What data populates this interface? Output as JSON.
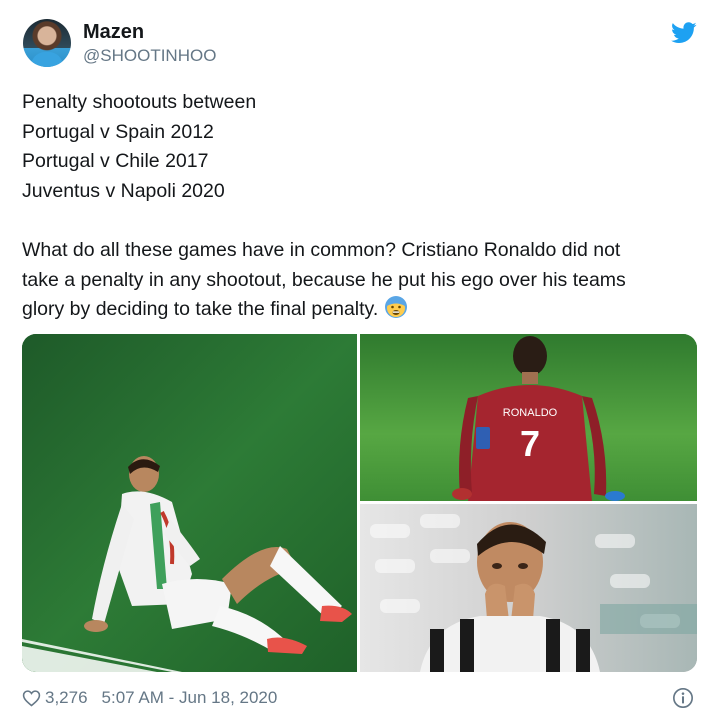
{
  "author": {
    "display_name": "Mazen",
    "handle": "@SHOOTINHOO",
    "avatar_icon": "user-avatar"
  },
  "tweet": {
    "lines_1": [
      "Penalty shootouts between",
      "Portugal v Spain 2012",
      "Portugal v Chile 2017",
      "Juventus v Napoli 2020"
    ],
    "lines_2": [
      "What do all these games have in common? Cristiano Ronaldo did not",
      "take a penalty in any shootout, because he put his ego over his teams",
      "glory by deciding to take the final penalty."
    ],
    "emoji": "face-with-open-mouth-cold-sweat"
  },
  "media": {
    "photos": [
      "player-sitting-on-pitch",
      "player-kneeling-back-number-7",
      "player-hands-on-face"
    ],
    "jersey_name": "RONALDO",
    "jersey_number": "7"
  },
  "footer": {
    "likes": "3,276",
    "timestamp": "5:07 AM - Jun 18, 2020"
  },
  "colors": {
    "brand": "#1da1f2",
    "text": "#14171a",
    "secondary": "#657786"
  },
  "icons": [
    "twitter-bird-icon",
    "heart-icon",
    "info-icon"
  ]
}
